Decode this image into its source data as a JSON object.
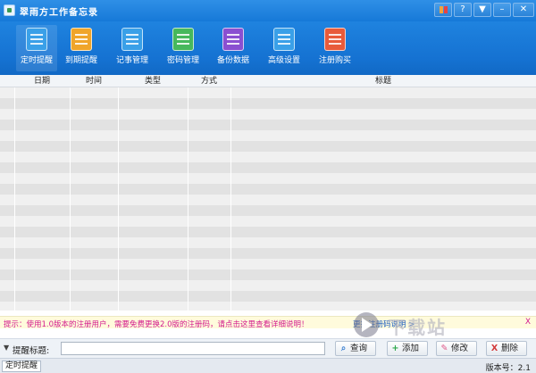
{
  "window": {
    "title": "翠雨方工作备忘录",
    "buttons": [
      "skin",
      "help",
      "menu",
      "minimize",
      "close"
    ]
  },
  "toolbar": {
    "items": [
      {
        "label": "定时提醒",
        "icon": "alarm-clock-icon",
        "color": "#3aa0e8",
        "active": true
      },
      {
        "label": "到期提醒",
        "icon": "checklist-icon",
        "color": "#f0a52a"
      },
      {
        "label": "记事管理",
        "icon": "notepad-icon",
        "color": "#3aa0e8"
      },
      {
        "label": "密码管理",
        "icon": "keyboard-icon",
        "color": "#46b85c"
      },
      {
        "label": "备份数据",
        "icon": "backup-icon",
        "color": "#8a4fd1"
      },
      {
        "label": "高级设置",
        "icon": "settings-icon",
        "color": "#3aa0e8"
      },
      {
        "label": "注册购买",
        "icon": "register-icon",
        "color": "#e85b3a"
      }
    ],
    "active_bar_colors": [
      "#e94c7c",
      "#5fc35f",
      "#4aa7f0"
    ]
  },
  "grid": {
    "columns": [
      "日期",
      "时间",
      "类型",
      "方式",
      "标题"
    ],
    "row_count": 21
  },
  "notice": {
    "text": "提示：使用1.0版本的注册用户，需要免费更换2.0版的注册码，请点击这里查看详细说明！",
    "link": "更换注册码说明 >",
    "close": "X"
  },
  "reminder": {
    "expander": "▼",
    "label": "提醒标题:",
    "value": ""
  },
  "actions": {
    "query": "查询",
    "add": "添加",
    "edit": "修改",
    "delete": "删除"
  },
  "status": {
    "left": "定时提醒",
    "version": "版本号：2.1"
  },
  "watermark": {
    "text": "下载站"
  }
}
